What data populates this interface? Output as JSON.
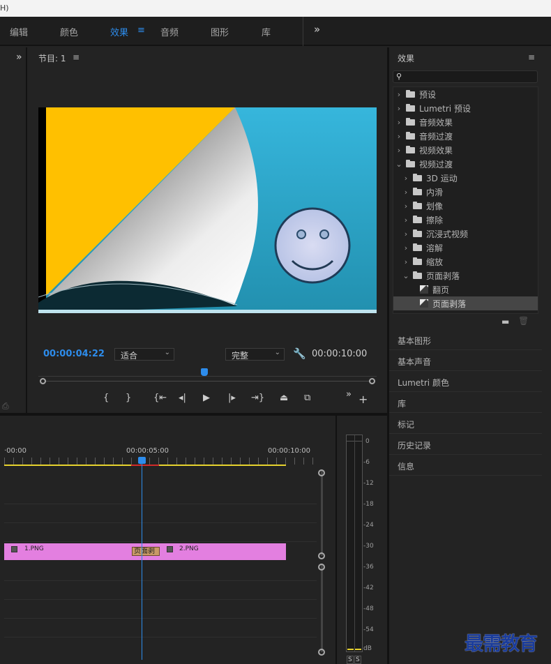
{
  "menubar": {
    "fragment": "H)"
  },
  "workspaces": {
    "tabs": [
      {
        "label": "编辑"
      },
      {
        "label": "颜色"
      },
      {
        "label": "效果"
      },
      {
        "label": "音频"
      },
      {
        "label": "图形"
      },
      {
        "label": "库"
      }
    ],
    "more": "»"
  },
  "program_monitor": {
    "title": "节目: 1",
    "menu_icon": "≡",
    "timecode": "00:00:04:22",
    "fit_select": "适合",
    "quality_select": "完整",
    "duration": "00:00:10:00",
    "playhead_fraction": 0.49,
    "preview": {
      "sky_color": "#34b1d6",
      "page_color": "#ffc000"
    }
  },
  "transport": {
    "mark_in": "{",
    "mark_out": "}",
    "more": "»",
    "add": "+"
  },
  "effects_panel": {
    "title": "效果",
    "search_placeholder": "",
    "tree": [
      {
        "label": "预设",
        "chev": "›",
        "kind": "preset",
        "indent": 0
      },
      {
        "label": "Lumetri 预设",
        "chev": "›",
        "kind": "preset",
        "indent": 0
      },
      {
        "label": "音频效果",
        "chev": "›",
        "kind": "folder",
        "indent": 0
      },
      {
        "label": "音频过渡",
        "chev": "›",
        "kind": "folder",
        "indent": 0
      },
      {
        "label": "视频效果",
        "chev": "›",
        "kind": "folder",
        "indent": 0
      },
      {
        "label": "视频过渡",
        "chev": "⌄",
        "kind": "folder",
        "indent": 0
      },
      {
        "label": "3D 运动",
        "chev": "›",
        "kind": "folder",
        "indent": 1
      },
      {
        "label": "内滑",
        "chev": "›",
        "kind": "folder",
        "indent": 1
      },
      {
        "label": "划像",
        "chev": "›",
        "kind": "folder",
        "indent": 1
      },
      {
        "label": "擦除",
        "chev": "›",
        "kind": "folder",
        "indent": 1
      },
      {
        "label": "沉浸式视频",
        "chev": "›",
        "kind": "folder",
        "indent": 1
      },
      {
        "label": "溶解",
        "chev": "›",
        "kind": "folder",
        "indent": 1
      },
      {
        "label": "缩放",
        "chev": "›",
        "kind": "folder",
        "indent": 1
      },
      {
        "label": "页面剥落",
        "chev": "⌄",
        "kind": "folder",
        "indent": 1
      },
      {
        "label": "翻页",
        "chev": "",
        "kind": "fx",
        "indent": 2
      },
      {
        "label": "页面剥落",
        "chev": "",
        "kind": "fx",
        "indent": 2,
        "selected": true
      }
    ]
  },
  "side_panels": [
    "基本图形",
    "基本声音",
    "Lumetri 颜色",
    "库",
    "标记",
    "历史记录",
    "信息"
  ],
  "timeline": {
    "ruler": [
      "·00:00",
      "00:00:05:00",
      "00:00:10:00"
    ],
    "clips": [
      {
        "name": "1.PNG"
      },
      {
        "name": "2.PNG"
      }
    ],
    "transition_label": "页面剥",
    "clip_color": "#e37fe0"
  },
  "audio_meter": {
    "marks": [
      "0",
      "-6",
      "-12",
      "-18",
      "-24",
      "-30",
      "-36",
      "-42",
      "-48",
      "-54",
      "dB"
    ],
    "solo": [
      "S",
      "S"
    ]
  },
  "watermark": "最需教育"
}
